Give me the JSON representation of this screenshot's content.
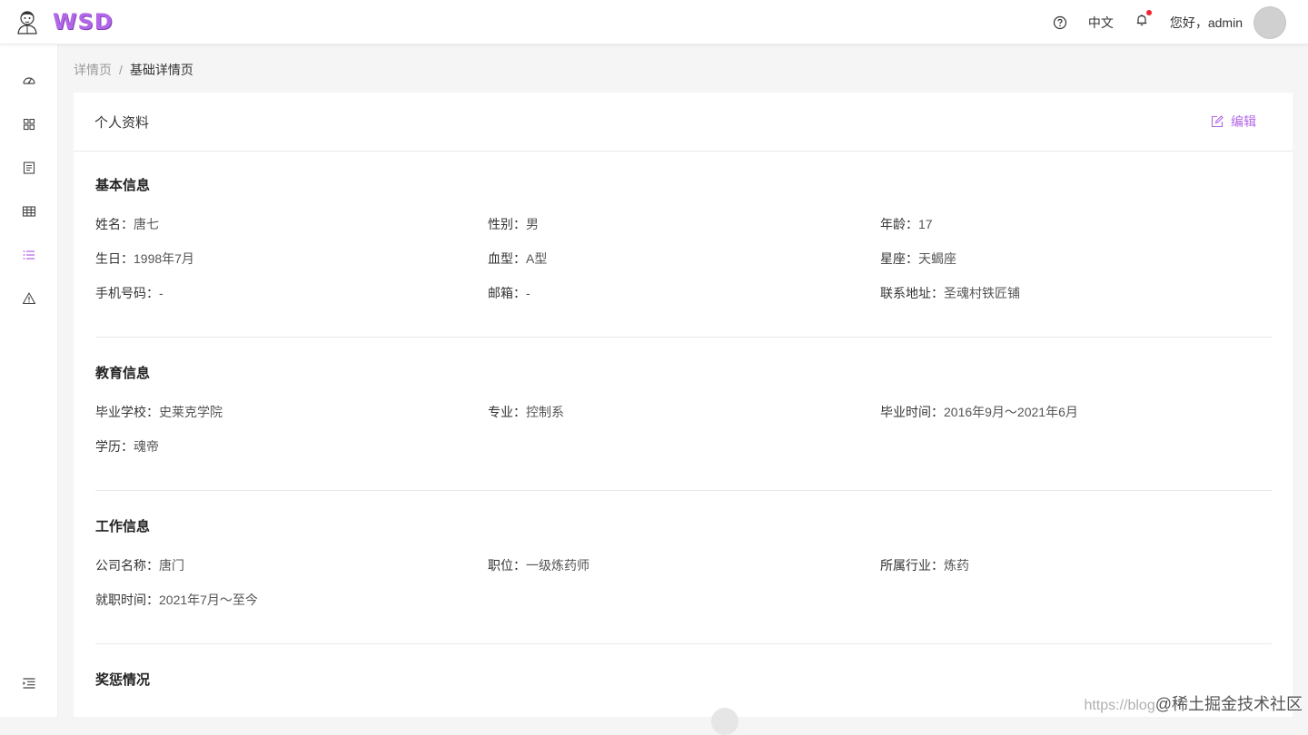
{
  "header": {
    "logo_text": "WSD",
    "lang": "中文",
    "greeting": "您好，admin",
    "help_icon": "question-circle-icon",
    "bell_icon": "bell-icon",
    "accent_color": "#b266e8",
    "notify_dot_color": "#f5222d"
  },
  "sidebar": {
    "items": [
      {
        "icon": "dashboard-icon",
        "active": false
      },
      {
        "icon": "appstore-icon",
        "active": false
      },
      {
        "icon": "form-icon",
        "active": false
      },
      {
        "icon": "table-icon",
        "active": false
      },
      {
        "icon": "list-icon",
        "active": true
      },
      {
        "icon": "warning-icon",
        "active": false
      }
    ],
    "collapse_icon": "menu-fold-icon"
  },
  "breadcrumb": {
    "parent": "详情页",
    "separator": "/",
    "current": "基础详情页"
  },
  "card": {
    "title": "个人资料",
    "edit_label": "编辑"
  },
  "sections": {
    "basic": {
      "title": "基本信息",
      "fields": [
        {
          "label": "姓名：",
          "value": "唐七"
        },
        {
          "label": "性别：",
          "value": "男"
        },
        {
          "label": "年龄：",
          "value": "17"
        },
        {
          "label": "生日：",
          "value": "1998年7月"
        },
        {
          "label": "血型：",
          "value": "A型"
        },
        {
          "label": "星座：",
          "value": "天蝎座"
        },
        {
          "label": "手机号码：",
          "value": "-"
        },
        {
          "label": "邮箱：",
          "value": "-"
        },
        {
          "label": "联系地址：",
          "value": "圣魂村铁匠铺"
        }
      ]
    },
    "education": {
      "title": "教育信息",
      "fields": [
        {
          "label": "毕业学校：",
          "value": "史莱克学院"
        },
        {
          "label": "专业：",
          "value": "控制系"
        },
        {
          "label": "毕业时间：",
          "value": "2016年9月～2021年6月"
        },
        {
          "label": "学历：",
          "value": "魂帝"
        }
      ]
    },
    "work": {
      "title": "工作信息",
      "fields": [
        {
          "label": "公司名称：",
          "value": "唐门"
        },
        {
          "label": "职位：",
          "value": "一级炼药师"
        },
        {
          "label": "所属行业：",
          "value": "炼药"
        },
        {
          "label": "就职时间：",
          "value": "2021年7月～至今"
        }
      ]
    },
    "rewards": {
      "title": "奖惩情况"
    }
  },
  "watermark": {
    "url": "https://blog",
    "brand": "@稀土掘金技术社区"
  }
}
